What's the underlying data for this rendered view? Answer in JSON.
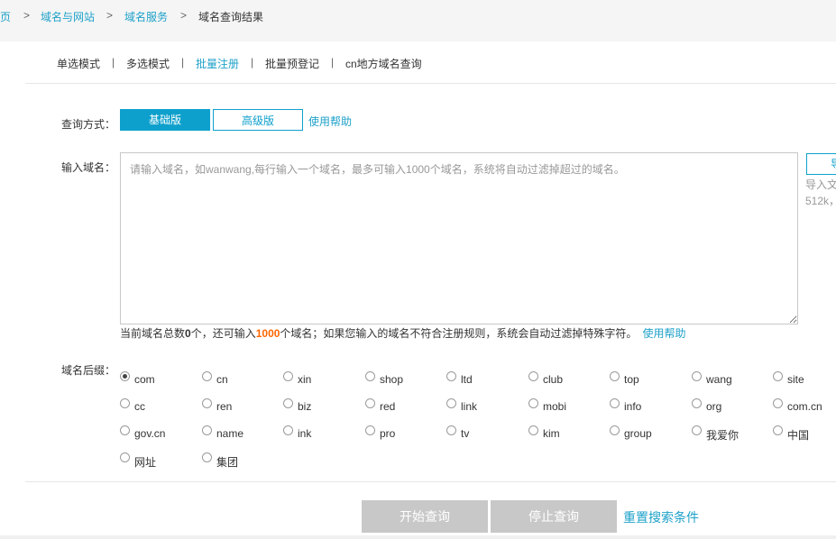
{
  "breadcrumb": {
    "home": "页",
    "sep": ">",
    "level1": "域名与网站",
    "level2": "域名服务",
    "current": "域名查询结果"
  },
  "tabs": [
    "单选模式",
    "多选模式",
    "批量注册",
    "批量预登记",
    "cn地方域名查询"
  ],
  "tab_separator": "|",
  "active_tab": "批量注册",
  "query_mode": {
    "label": "查询方式：",
    "basic": "基础版",
    "advanced": "高级版",
    "help": "使用帮助"
  },
  "domain_input": {
    "label": "输入域名：",
    "placeholder": "请输入域名，如wanwang,每行输入一个域名，最多可输入1000个域名，系统将自动过滤掉超过的域名。",
    "value": ""
  },
  "import": {
    "button": "导",
    "tip_line1": "导入文",
    "tip_line2": "512k，"
  },
  "count_line": {
    "prefix": "当前域名总数",
    "total": "0",
    "middle": "个，还可输入",
    "remaining": "1000",
    "suffix": "个域名；如果您输入的域名不符合注册规则，系统会自动过滤掉特殊字符。",
    "help": "使用帮助"
  },
  "suffix": {
    "label": "域名后缀：",
    "selected": "com",
    "options": [
      "com",
      "cn",
      "xin",
      "shop",
      "ltd",
      "club",
      "top",
      "wang",
      "site",
      "cc",
      "ren",
      "biz",
      "red",
      "link",
      "mobi",
      "info",
      "org",
      "com.cn",
      "gov.cn",
      "name",
      "ink",
      "pro",
      "tv",
      "kim",
      "group",
      "我爱你",
      "中国",
      "网址",
      "集团"
    ]
  },
  "actions": {
    "start": "开始查询",
    "stop": "停止查询",
    "reset": "重置搜索条件"
  },
  "colors": {
    "accent": "#0ea0cc",
    "link": "#1ea1c9",
    "highlight": "#ff6600",
    "disabled_button": "#c8c8c8"
  }
}
